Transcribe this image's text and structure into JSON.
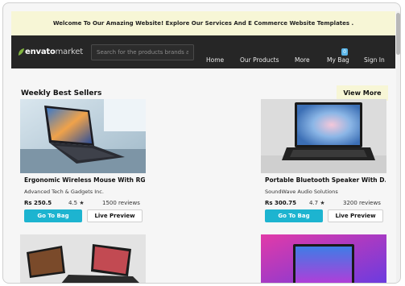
{
  "announcement": "Welcome To Our Amazing Website! Explore Our Services And E Commerce Website Templates .",
  "navbar": {
    "logo_bold": "envato",
    "logo_rest": "market",
    "search_placeholder": "Search for the products brands and more",
    "links": [
      "Home",
      "Our Products",
      "More",
      "My Bag",
      "Sign In"
    ],
    "bag_count": "0"
  },
  "section": {
    "title": "Weekly Best Sellers",
    "view_more": "View More"
  },
  "products": [
    {
      "name": "Ergonomic Wireless Mouse With RG...",
      "vendor": "Advanced Tech & Gadgets Inc.",
      "price": "Rs 250.5",
      "rating": "4.5 ★",
      "reviews": "1500 reviews",
      "bag_label": "Go To Bag",
      "preview_label": "Live Preview"
    },
    {
      "name": "Portable Bluetooth Speaker With D...",
      "vendor": "SoundWave Audio Solutions",
      "price": "Rs 300.75",
      "rating": "4.7 ★",
      "reviews": "3200 reviews",
      "bag_label": "Go To Bag",
      "preview_label": "Live Preview"
    }
  ],
  "colors": {
    "announce_bg": "#f7f6d6",
    "navbar_bg": "#262626",
    "accent": "#1db4d0",
    "logo_green": "#82b541"
  }
}
